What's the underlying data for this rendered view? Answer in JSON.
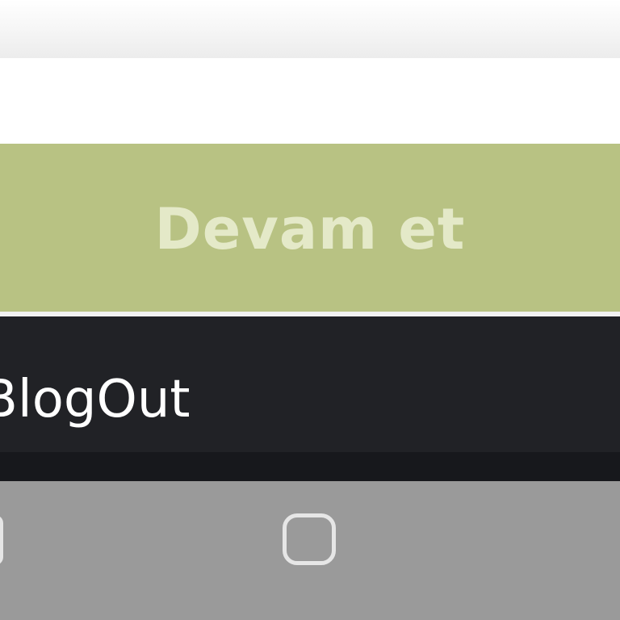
{
  "continue_button": {
    "label": "Devam et",
    "bg_color": "#b8c283",
    "text_color": "#e4e9c8"
  },
  "footer": {
    "brand": "BlogOut",
    "bg_color": "#212226"
  },
  "nav_bar": {
    "bg_color": "#9a9a9a",
    "icons": [
      "back-icon",
      "home-icon"
    ]
  }
}
